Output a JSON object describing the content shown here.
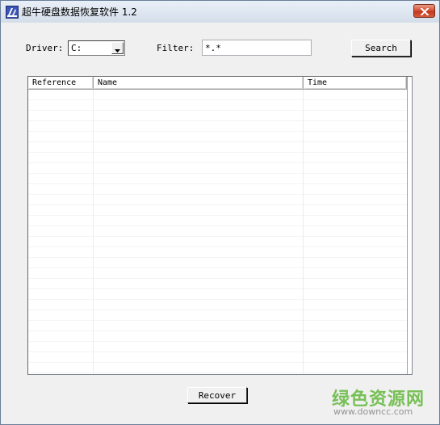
{
  "window": {
    "title": "超牛硬盘数据恢复软件 1.2"
  },
  "toolbar": {
    "driver_label": "Driver:",
    "driver_value": "C:",
    "filter_label": "Filter:",
    "filter_value": "*.*",
    "search_label": "Search"
  },
  "file_list": {
    "columns": [
      "Reference",
      "Name",
      "Time"
    ],
    "rows": []
  },
  "footer": {
    "recover_label": "Recover"
  },
  "watermark": {
    "brand": "绿色资源网",
    "url": "www.downcc.com"
  },
  "colors": {
    "titlebar": "#dfe7f1",
    "close_button": "#c94b32",
    "dialog_face": "#f0f0f0",
    "watermark_green": "#62b83b"
  },
  "icons": {
    "app": "app-icon",
    "close": "close-icon",
    "dropdown": "chevron-down-icon"
  }
}
